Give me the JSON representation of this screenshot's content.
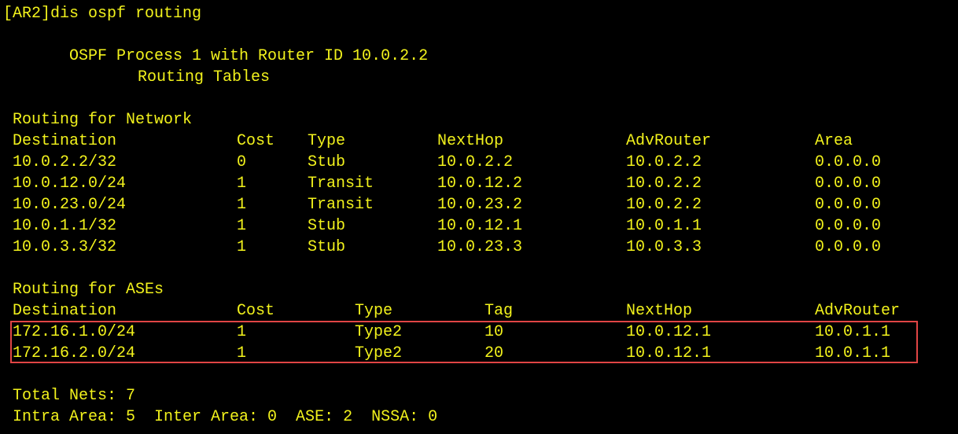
{
  "colors": {
    "background": "#000000",
    "text": "#f2f21c",
    "highlight_border": "#e04545"
  },
  "command_line": "[AR2]dis ospf routing",
  "header": {
    "process_line": "OSPF Process 1 with Router ID 10.0.2.2",
    "tables_line": "Routing Tables"
  },
  "network_section": {
    "title": "Routing for Network",
    "columns": {
      "destination": "Destination",
      "cost": "Cost",
      "type": "Type",
      "nexthop": "NextHop",
      "advrouter": "AdvRouter",
      "area": "Area"
    },
    "rows": [
      {
        "destination": "10.0.2.2/32",
        "cost": "0",
        "type": "Stub",
        "nexthop": "10.0.2.2",
        "advrouter": "10.0.2.2",
        "area": "0.0.0.0"
      },
      {
        "destination": "10.0.12.0/24",
        "cost": "1",
        "type": "Transit",
        "nexthop": "10.0.12.2",
        "advrouter": "10.0.2.2",
        "area": "0.0.0.0"
      },
      {
        "destination": "10.0.23.0/24",
        "cost": "1",
        "type": "Transit",
        "nexthop": "10.0.23.2",
        "advrouter": "10.0.2.2",
        "area": "0.0.0.0"
      },
      {
        "destination": "10.0.1.1/32",
        "cost": "1",
        "type": "Stub",
        "nexthop": "10.0.12.1",
        "advrouter": "10.0.1.1",
        "area": "0.0.0.0"
      },
      {
        "destination": "10.0.3.3/32",
        "cost": "1",
        "type": "Stub",
        "nexthop": "10.0.23.3",
        "advrouter": "10.0.3.3",
        "area": "0.0.0.0"
      }
    ]
  },
  "ase_section": {
    "title": "Routing for ASEs",
    "columns": {
      "destination": "Destination",
      "cost": "Cost",
      "type": "Type",
      "tag": "Tag",
      "nexthop": "NextHop",
      "advrouter": "AdvRouter"
    },
    "rows": [
      {
        "destination": "172.16.1.0/24",
        "cost": "1",
        "type": "Type2",
        "tag": "10",
        "nexthop": "10.0.12.1",
        "advrouter": "10.0.1.1"
      },
      {
        "destination": "172.16.2.0/24",
        "cost": "1",
        "type": "Type2",
        "tag": "20",
        "nexthop": "10.0.12.1",
        "advrouter": "10.0.1.1"
      }
    ]
  },
  "summary": {
    "total_nets": "Total Nets: 7",
    "area_counts": "Intra Area: 5  Inter Area: 0  ASE: 2  NSSA: 0"
  }
}
